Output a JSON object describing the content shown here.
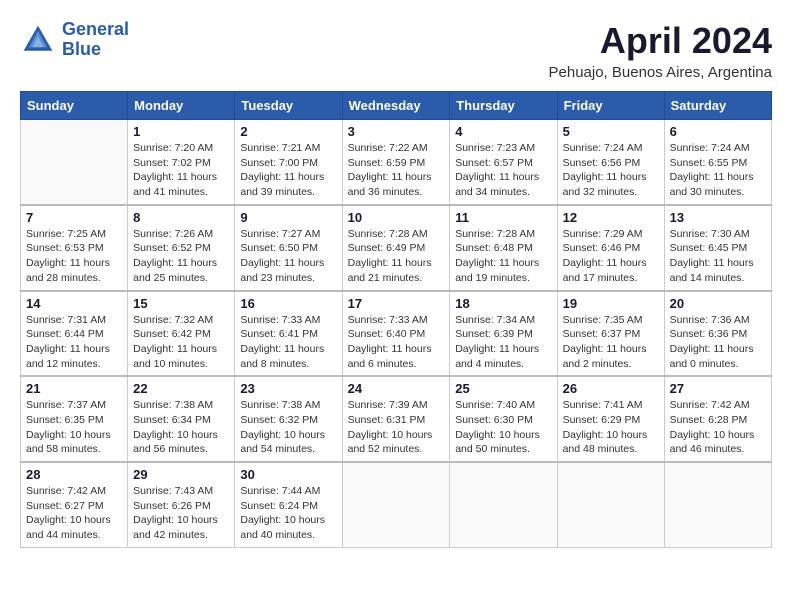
{
  "header": {
    "logo_line1": "General",
    "logo_line2": "Blue",
    "month_title": "April 2024",
    "subtitle": "Pehuajo, Buenos Aires, Argentina"
  },
  "days_of_week": [
    "Sunday",
    "Monday",
    "Tuesday",
    "Wednesday",
    "Thursday",
    "Friday",
    "Saturday"
  ],
  "weeks": [
    [
      {
        "day": "",
        "sunrise": "",
        "sunset": "",
        "daylight": ""
      },
      {
        "day": "1",
        "sunrise": "Sunrise: 7:20 AM",
        "sunset": "Sunset: 7:02 PM",
        "daylight": "Daylight: 11 hours and 41 minutes."
      },
      {
        "day": "2",
        "sunrise": "Sunrise: 7:21 AM",
        "sunset": "Sunset: 7:00 PM",
        "daylight": "Daylight: 11 hours and 39 minutes."
      },
      {
        "day": "3",
        "sunrise": "Sunrise: 7:22 AM",
        "sunset": "Sunset: 6:59 PM",
        "daylight": "Daylight: 11 hours and 36 minutes."
      },
      {
        "day": "4",
        "sunrise": "Sunrise: 7:23 AM",
        "sunset": "Sunset: 6:57 PM",
        "daylight": "Daylight: 11 hours and 34 minutes."
      },
      {
        "day": "5",
        "sunrise": "Sunrise: 7:24 AM",
        "sunset": "Sunset: 6:56 PM",
        "daylight": "Daylight: 11 hours and 32 minutes."
      },
      {
        "day": "6",
        "sunrise": "Sunrise: 7:24 AM",
        "sunset": "Sunset: 6:55 PM",
        "daylight": "Daylight: 11 hours and 30 minutes."
      }
    ],
    [
      {
        "day": "7",
        "sunrise": "Sunrise: 7:25 AM",
        "sunset": "Sunset: 6:53 PM",
        "daylight": "Daylight: 11 hours and 28 minutes."
      },
      {
        "day": "8",
        "sunrise": "Sunrise: 7:26 AM",
        "sunset": "Sunset: 6:52 PM",
        "daylight": "Daylight: 11 hours and 25 minutes."
      },
      {
        "day": "9",
        "sunrise": "Sunrise: 7:27 AM",
        "sunset": "Sunset: 6:50 PM",
        "daylight": "Daylight: 11 hours and 23 minutes."
      },
      {
        "day": "10",
        "sunrise": "Sunrise: 7:28 AM",
        "sunset": "Sunset: 6:49 PM",
        "daylight": "Daylight: 11 hours and 21 minutes."
      },
      {
        "day": "11",
        "sunrise": "Sunrise: 7:28 AM",
        "sunset": "Sunset: 6:48 PM",
        "daylight": "Daylight: 11 hours and 19 minutes."
      },
      {
        "day": "12",
        "sunrise": "Sunrise: 7:29 AM",
        "sunset": "Sunset: 6:46 PM",
        "daylight": "Daylight: 11 hours and 17 minutes."
      },
      {
        "day": "13",
        "sunrise": "Sunrise: 7:30 AM",
        "sunset": "Sunset: 6:45 PM",
        "daylight": "Daylight: 11 hours and 14 minutes."
      }
    ],
    [
      {
        "day": "14",
        "sunrise": "Sunrise: 7:31 AM",
        "sunset": "Sunset: 6:44 PM",
        "daylight": "Daylight: 11 hours and 12 minutes."
      },
      {
        "day": "15",
        "sunrise": "Sunrise: 7:32 AM",
        "sunset": "Sunset: 6:42 PM",
        "daylight": "Daylight: 11 hours and 10 minutes."
      },
      {
        "day": "16",
        "sunrise": "Sunrise: 7:33 AM",
        "sunset": "Sunset: 6:41 PM",
        "daylight": "Daylight: 11 hours and 8 minutes."
      },
      {
        "day": "17",
        "sunrise": "Sunrise: 7:33 AM",
        "sunset": "Sunset: 6:40 PM",
        "daylight": "Daylight: 11 hours and 6 minutes."
      },
      {
        "day": "18",
        "sunrise": "Sunrise: 7:34 AM",
        "sunset": "Sunset: 6:39 PM",
        "daylight": "Daylight: 11 hours and 4 minutes."
      },
      {
        "day": "19",
        "sunrise": "Sunrise: 7:35 AM",
        "sunset": "Sunset: 6:37 PM",
        "daylight": "Daylight: 11 hours and 2 minutes."
      },
      {
        "day": "20",
        "sunrise": "Sunrise: 7:36 AM",
        "sunset": "Sunset: 6:36 PM",
        "daylight": "Daylight: 11 hours and 0 minutes."
      }
    ],
    [
      {
        "day": "21",
        "sunrise": "Sunrise: 7:37 AM",
        "sunset": "Sunset: 6:35 PM",
        "daylight": "Daylight: 10 hours and 58 minutes."
      },
      {
        "day": "22",
        "sunrise": "Sunrise: 7:38 AM",
        "sunset": "Sunset: 6:34 PM",
        "daylight": "Daylight: 10 hours and 56 minutes."
      },
      {
        "day": "23",
        "sunrise": "Sunrise: 7:38 AM",
        "sunset": "Sunset: 6:32 PM",
        "daylight": "Daylight: 10 hours and 54 minutes."
      },
      {
        "day": "24",
        "sunrise": "Sunrise: 7:39 AM",
        "sunset": "Sunset: 6:31 PM",
        "daylight": "Daylight: 10 hours and 52 minutes."
      },
      {
        "day": "25",
        "sunrise": "Sunrise: 7:40 AM",
        "sunset": "Sunset: 6:30 PM",
        "daylight": "Daylight: 10 hours and 50 minutes."
      },
      {
        "day": "26",
        "sunrise": "Sunrise: 7:41 AM",
        "sunset": "Sunset: 6:29 PM",
        "daylight": "Daylight: 10 hours and 48 minutes."
      },
      {
        "day": "27",
        "sunrise": "Sunrise: 7:42 AM",
        "sunset": "Sunset: 6:28 PM",
        "daylight": "Daylight: 10 hours and 46 minutes."
      }
    ],
    [
      {
        "day": "28",
        "sunrise": "Sunrise: 7:42 AM",
        "sunset": "Sunset: 6:27 PM",
        "daylight": "Daylight: 10 hours and 44 minutes."
      },
      {
        "day": "29",
        "sunrise": "Sunrise: 7:43 AM",
        "sunset": "Sunset: 6:26 PM",
        "daylight": "Daylight: 10 hours and 42 minutes."
      },
      {
        "day": "30",
        "sunrise": "Sunrise: 7:44 AM",
        "sunset": "Sunset: 6:24 PM",
        "daylight": "Daylight: 10 hours and 40 minutes."
      },
      {
        "day": "",
        "sunrise": "",
        "sunset": "",
        "daylight": ""
      },
      {
        "day": "",
        "sunrise": "",
        "sunset": "",
        "daylight": ""
      },
      {
        "day": "",
        "sunrise": "",
        "sunset": "",
        "daylight": ""
      },
      {
        "day": "",
        "sunrise": "",
        "sunset": "",
        "daylight": ""
      }
    ]
  ]
}
